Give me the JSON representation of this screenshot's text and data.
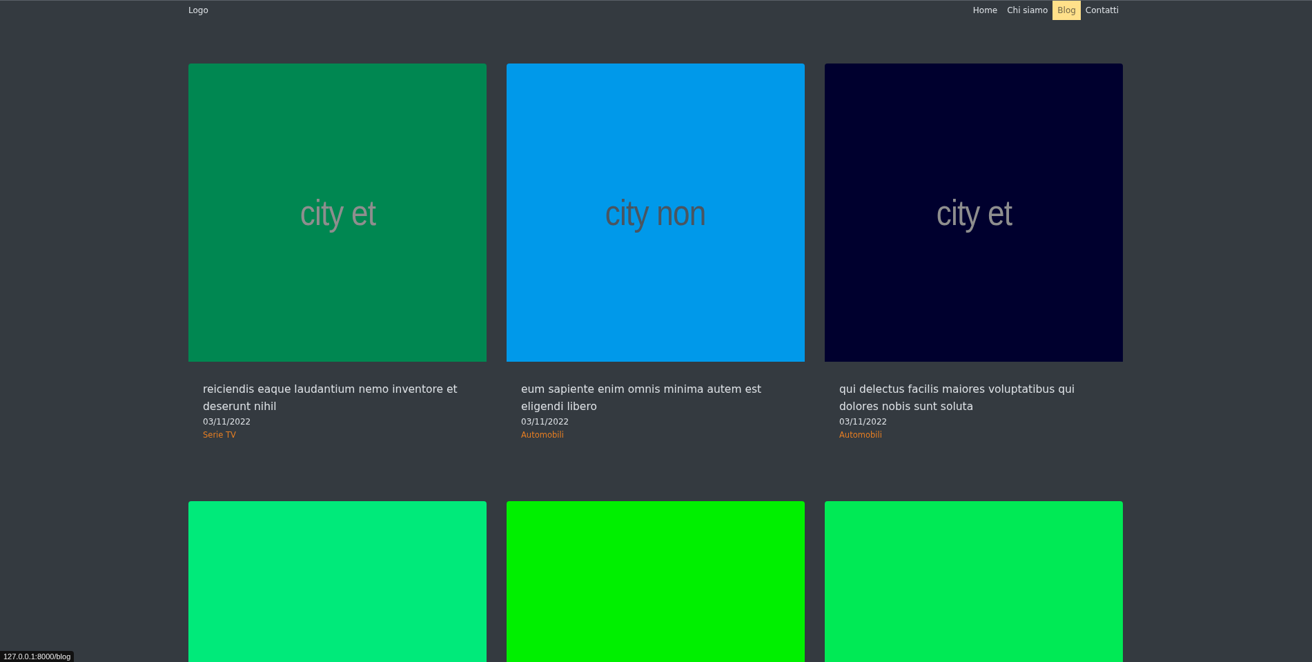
{
  "navbar": {
    "logo": "Logo",
    "links": [
      {
        "label": "Home",
        "selected": false
      },
      {
        "label": "Chi siamo",
        "selected": false
      },
      {
        "label": "Blog",
        "selected": true
      },
      {
        "label": "Contatti",
        "selected": false
      }
    ]
  },
  "posts": [
    {
      "image_text": "city et",
      "color": "#008751",
      "title": "reiciendis eaque laudantium nemo inventore et deserunt nihil",
      "date": "03/11/2022",
      "category": "Serie TV"
    },
    {
      "image_text": "city non",
      "color": "#0099ea",
      "title": "eum sapiente enim omnis minima autem est eligendi libero",
      "date": "03/11/2022",
      "category": "Automobili"
    },
    {
      "image_text": "city et",
      "color": "#00002e",
      "title": "qui delectus facilis maiores voluptatibus qui dolores nobis sunt soluta",
      "date": "03/11/2022",
      "category": "Automobili"
    },
    {
      "color": "#00ea7a"
    },
    {
      "color": "#00f000"
    },
    {
      "color": "#00ea55"
    }
  ],
  "status_bar": "127.0.0.1:8000/blog"
}
